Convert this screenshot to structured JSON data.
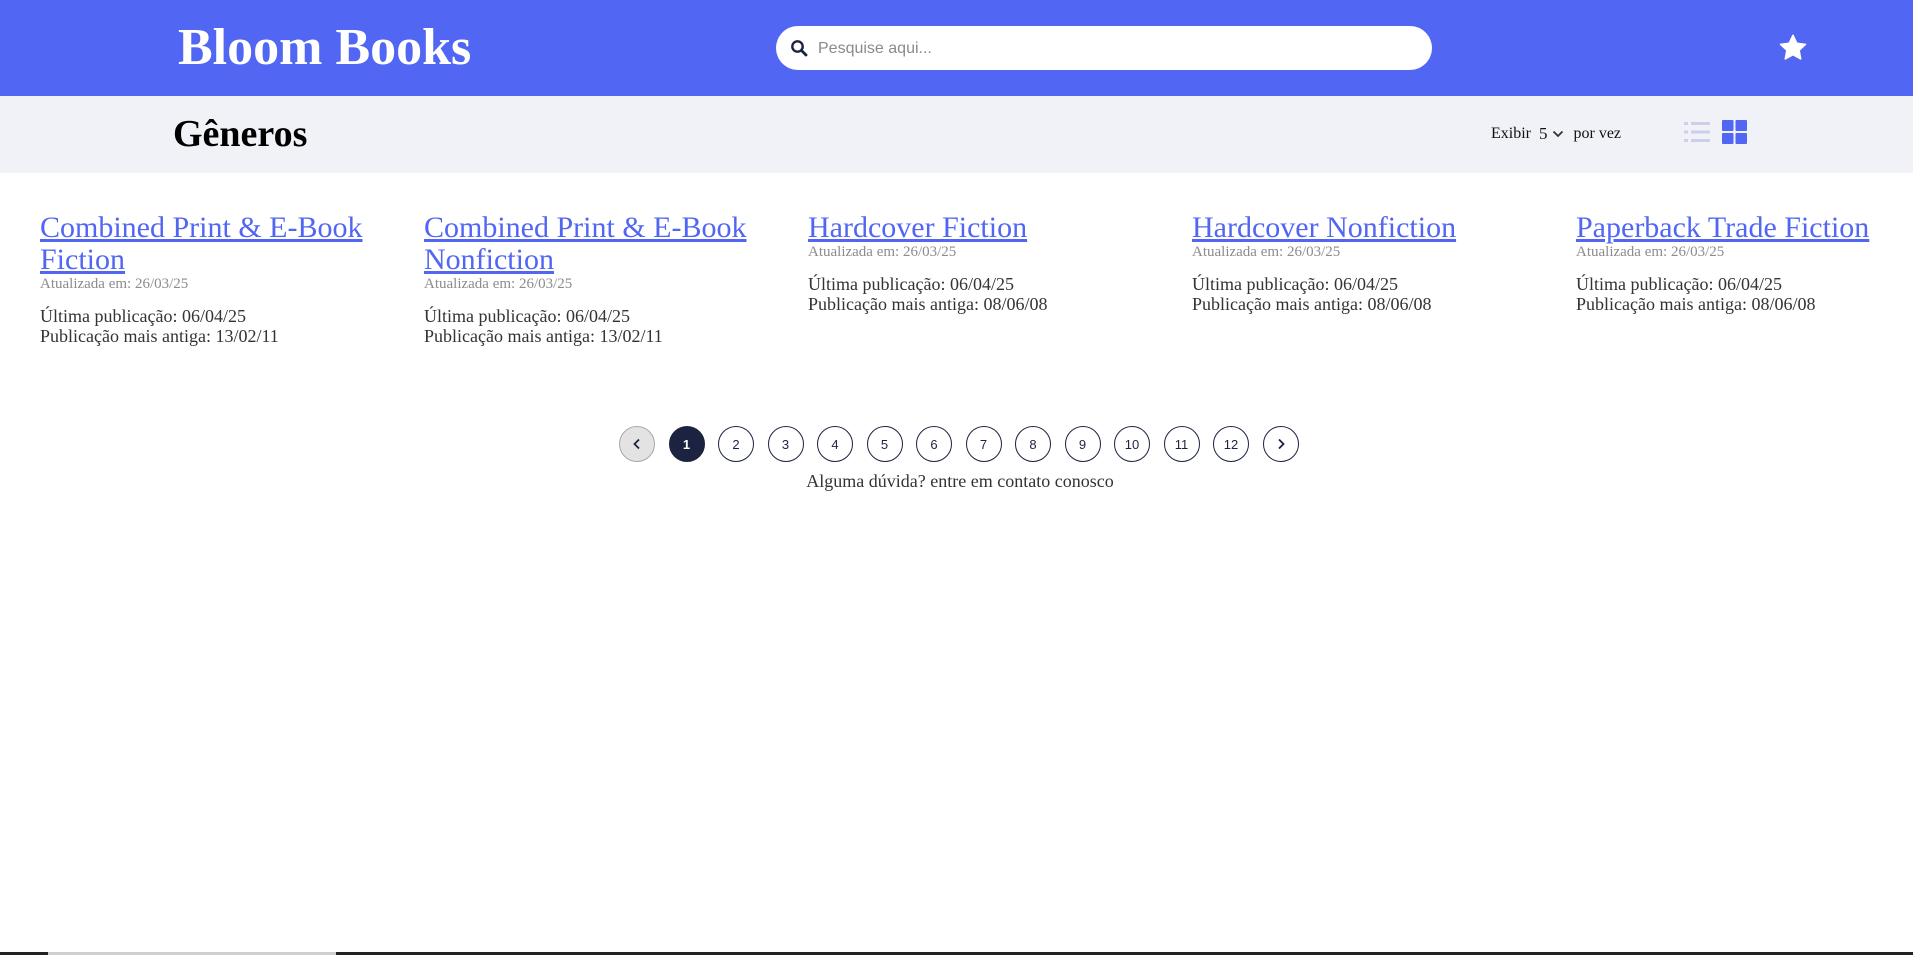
{
  "header": {
    "brand": "Bloom Books",
    "search_placeholder": "Pesquise aqui...",
    "favorites_icon": "star-icon",
    "color": "#5166f2"
  },
  "subheader": {
    "title": "Gêneros",
    "show_label": "Exibir",
    "per_page_value": "5",
    "per_page_suffix": "por vez",
    "view_modes": [
      "list",
      "grid"
    ],
    "active_view": "grid"
  },
  "cards": [
    {
      "title": "Combined Print & E-Book Fiction",
      "updated": "Atualizada em: 26/03/25",
      "last": "Última publicação: 06/04/25",
      "oldest": "Publicação mais antiga: 13/02/11"
    },
    {
      "title": "Combined Print & E-Book Nonfiction",
      "updated": "Atualizada em: 26/03/25",
      "last": "Última publicação: 06/04/25",
      "oldest": "Publicação mais antiga: 13/02/11"
    },
    {
      "title": "Hardcover Fiction",
      "updated": "Atualizada em: 26/03/25",
      "last": "Última publicação: 06/04/25",
      "oldest": "Publicação mais antiga: 08/06/08"
    },
    {
      "title": "Hardcover Nonfiction",
      "updated": "Atualizada em: 26/03/25",
      "last": "Última publicação: 06/04/25",
      "oldest": "Publicação mais antiga: 08/06/08"
    },
    {
      "title": "Paperback Trade Fiction",
      "updated": "Atualizada em: 26/03/25",
      "last": "Última publicação: 06/04/25",
      "oldest": "Publicação mais antiga: 08/06/08"
    }
  ],
  "pagination": {
    "pages": [
      "1",
      "2",
      "3",
      "4",
      "5",
      "6",
      "7",
      "8",
      "9",
      "10",
      "11",
      "12"
    ],
    "current": "1",
    "prev_icon": "chevron-left-icon",
    "next_icon": "chevron-right-icon"
  },
  "footer": {
    "contact": "Alguma dúvida? entre em contato conosco"
  }
}
